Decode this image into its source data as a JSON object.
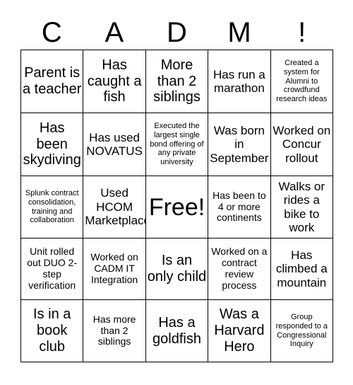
{
  "card": {
    "title_letters": [
      "C",
      "A",
      "D",
      "M",
      "!"
    ],
    "rows": [
      [
        {
          "text": "Parent is a teacher",
          "size": "lg"
        },
        {
          "text": "Has caught a fish",
          "size": "lg"
        },
        {
          "text": "More than 2 siblings",
          "size": "lg"
        },
        {
          "text": "Has run a marathon",
          "size": "md"
        },
        {
          "text": "Created a system for Alumni to crowdfund research ideas",
          "size": "xs"
        }
      ],
      [
        {
          "text": "Has been skydiving",
          "size": "lg"
        },
        {
          "text": "Has used NOVATUS",
          "size": "md"
        },
        {
          "text": "Executed the largest single bond offering of any private university",
          "size": "xs"
        },
        {
          "text": "Was born in September",
          "size": "md"
        },
        {
          "text": "Worked on Concur rollout",
          "size": "md"
        }
      ],
      [
        {
          "text": "Splunk contract consolidation, training and collaboration",
          "size": "xs"
        },
        {
          "text": "Used HCOM Marketplace",
          "size": "md"
        },
        {
          "text": "Free!",
          "size": "free"
        },
        {
          "text": "Has been to 4 or more continents",
          "size": "sm"
        },
        {
          "text": "Walks or rides a bike to work",
          "size": "md"
        }
      ],
      [
        {
          "text": "Unit rolled out DUO 2-step verification",
          "size": "sm"
        },
        {
          "text": "Worked on CADM IT Integration",
          "size": "sm"
        },
        {
          "text": "Is an only child",
          "size": "lg"
        },
        {
          "text": "Worked on a contract review process",
          "size": "sm"
        },
        {
          "text": "Has climbed a mountain",
          "size": "md"
        }
      ],
      [
        {
          "text": "Is in a book club",
          "size": "lg"
        },
        {
          "text": "Has more than 2 siblings",
          "size": "sm"
        },
        {
          "text": "Has a goldfish",
          "size": "lg"
        },
        {
          "text": "Was a Harvard Hero",
          "size": "lg"
        },
        {
          "text": "Group responded to a Congressional Inquiry",
          "size": "xs"
        }
      ]
    ]
  }
}
